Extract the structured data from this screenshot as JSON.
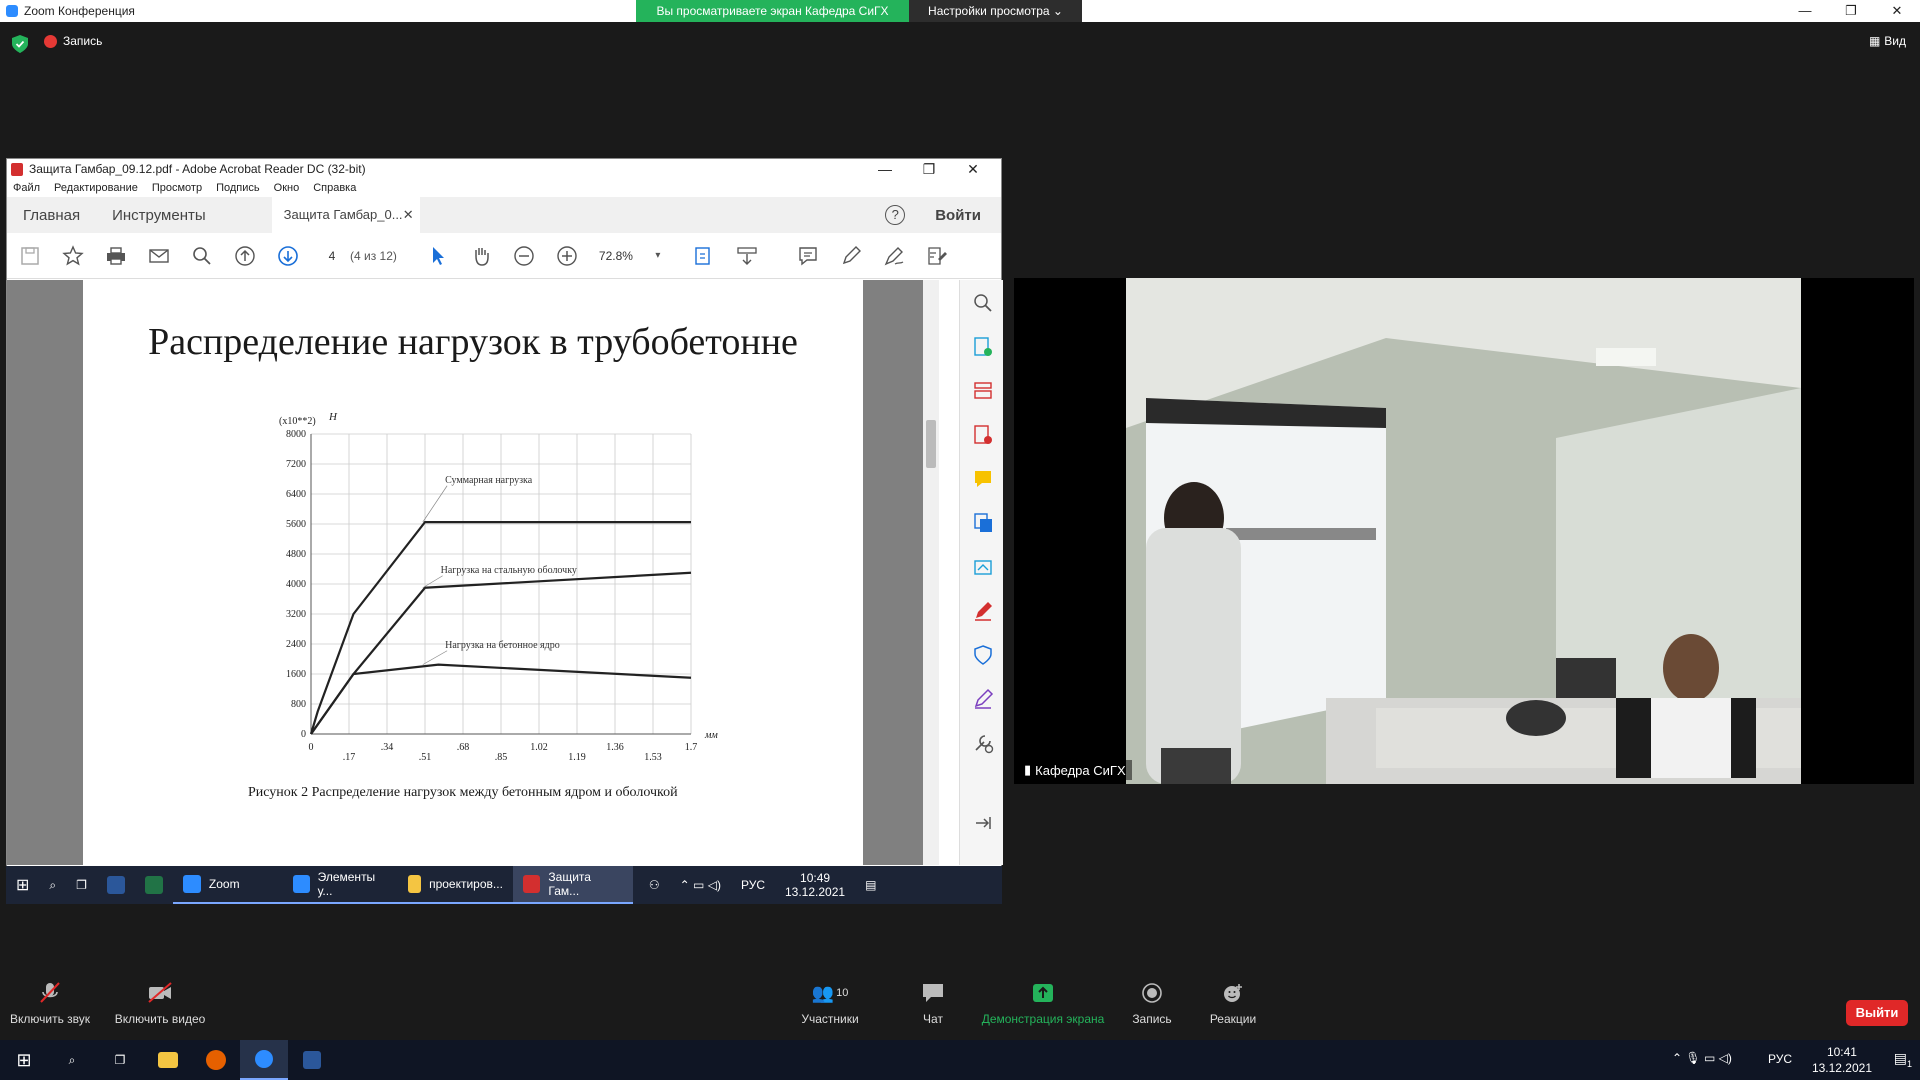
{
  "zoom": {
    "title": "Zoom Конференция",
    "share_banner": "Вы просматриваете экран Кафедра СиГХ",
    "view_options": "Настройки просмотра",
    "recording": "Запись",
    "view_button": "Вид",
    "participant_name": "Кафедра СиГХ",
    "controls": {
      "unmute": "Включить звук",
      "start_video": "Включить видео",
      "participants_count": "10",
      "participants": "Участники",
      "chat": "Чат",
      "share_screen": "Демонстрация экрана",
      "record": "Запись",
      "reactions": "Реакции",
      "leave": "Выйти"
    }
  },
  "acrobat": {
    "title": "Защита Гамбар_09.12.pdf - Adobe Acrobat Reader DC (32-bit)",
    "menu": [
      "Файл",
      "Редактирование",
      "Просмотр",
      "Подпись",
      "Окно",
      "Справка"
    ],
    "tabs": {
      "home": "Главная",
      "tools": "Инструменты",
      "doc": "Защита Гамбар_0..."
    },
    "login": "Войти",
    "help": "?",
    "page_number": "4",
    "page_of": "(4 из 12)",
    "zoom": "72.8%"
  },
  "document": {
    "title": "Распределение нагрузок в трубобетонне",
    "caption": "Рисунок 2 Распределение нагрузок между бетонным ядром и оболочкой"
  },
  "chart_data": {
    "type": "line",
    "ylabel": "Н",
    "y_multiplier": "(x10**2)",
    "xlabel": "мм",
    "yticks": [
      "0",
      "800",
      "1600",
      "2400",
      "3200",
      "4000",
      "4800",
      "5600",
      "6400",
      "7200",
      "8000"
    ],
    "xticks": [
      "0",
      ".17",
      ".34",
      ".51",
      ".68",
      ".85",
      "1.02",
      "1.19",
      "1.36",
      "1.53",
      "1.7"
    ],
    "ylim": [
      0,
      8000
    ],
    "xlim": [
      0,
      1.7
    ],
    "grid": true,
    "series": [
      {
        "name": "Суммарная нагрузка",
        "x": [
          0,
          0.03,
          0.19,
          0.51,
          1.7
        ],
        "y": [
          0,
          600,
          3200,
          5650,
          5650
        ]
      },
      {
        "name": "Нагрузка на стальную оболочку",
        "x": [
          0,
          0.19,
          0.51,
          1.7
        ],
        "y": [
          0,
          1600,
          3900,
          4300
        ]
      },
      {
        "name": "Нагрузка на бетонное ядро",
        "x": [
          0,
          0.19,
          0.57,
          1.7
        ],
        "y": [
          0,
          1600,
          1850,
          1500
        ]
      }
    ]
  },
  "remote_taskbar": {
    "apps": [
      "Zoom",
      "Элементы у...",
      "проектиров...",
      "Защита Гам..."
    ],
    "lang": "РУС",
    "time": "10:49",
    "date": "13.12.2021"
  },
  "win_taskbar": {
    "lang": "РУС",
    "time": "10:41",
    "date": "13.12.2021",
    "notif_count": "1"
  }
}
